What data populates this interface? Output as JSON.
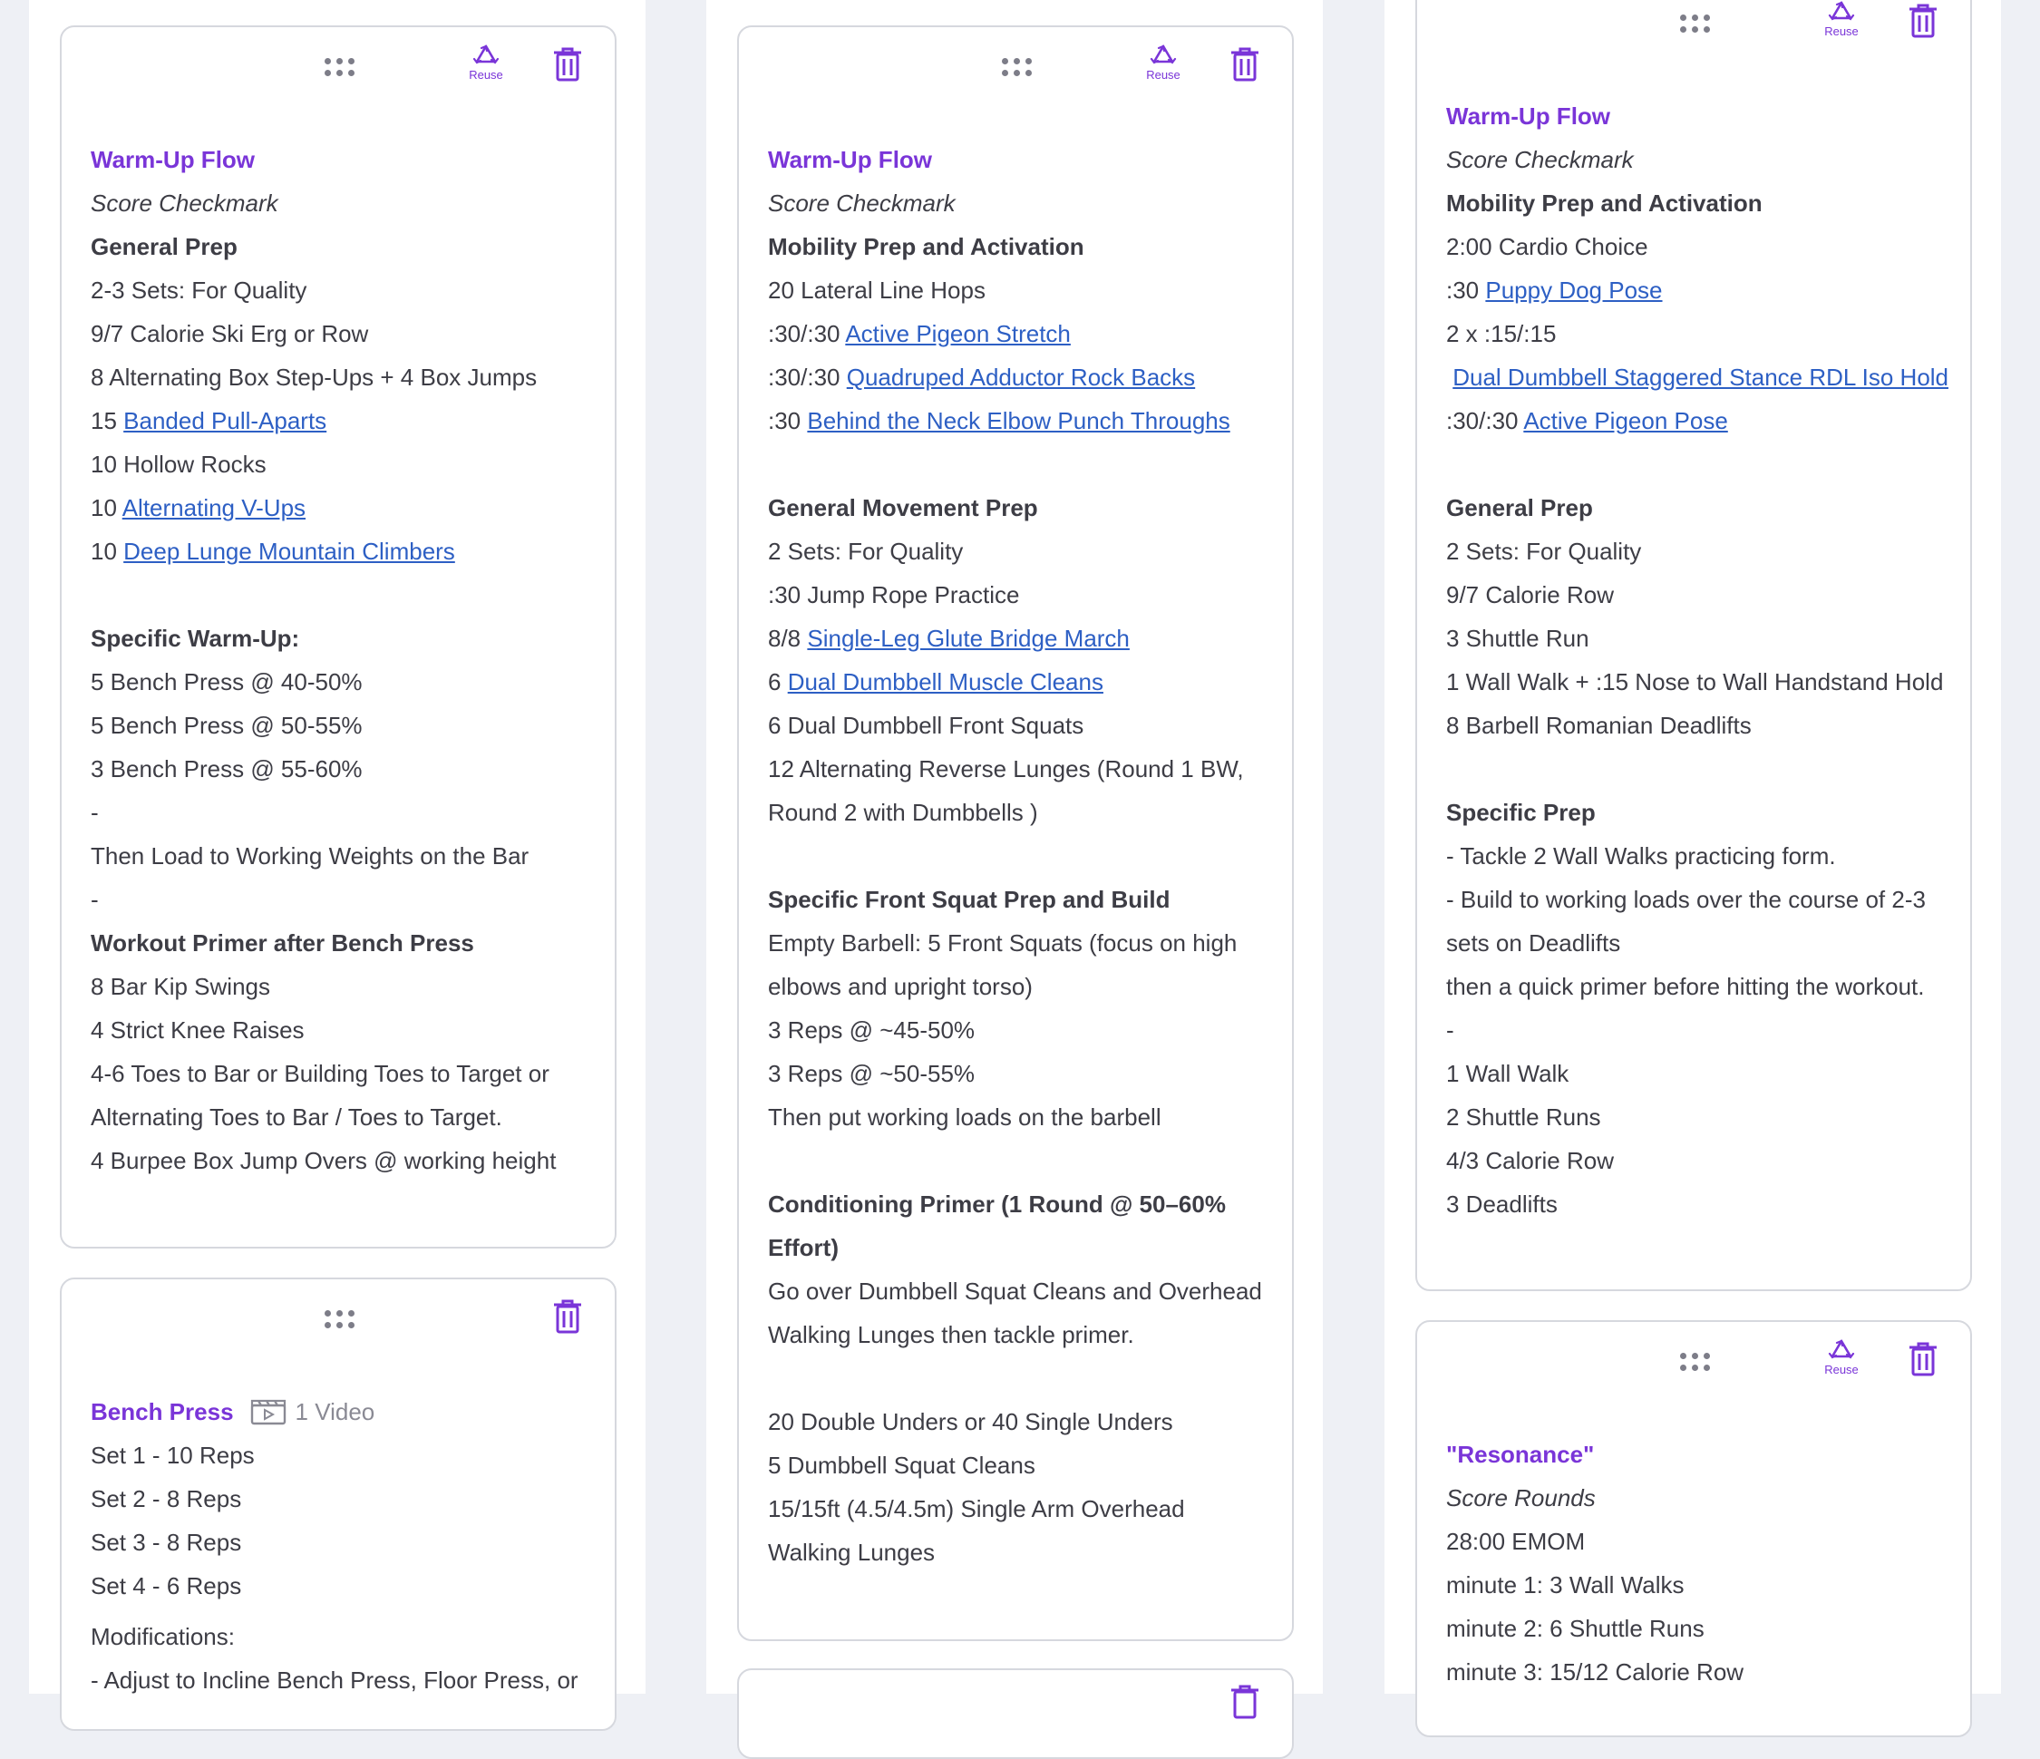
{
  "colors": {
    "accent": "#7a35d8",
    "link": "#2d5fc4",
    "text": "#3d3d45",
    "border": "#d6d8de",
    "background": "#eef0f5"
  },
  "icons": {
    "drag": "drag-dots-icon",
    "reuse": "recycle-icon",
    "delete": "trash-icon",
    "video": "video-clapper-icon"
  },
  "common": {
    "reuse_label": "Reuse"
  },
  "column1": {
    "card1": {
      "title": "Warm-Up Flow",
      "score": "Score Checkmark",
      "l1": "General Prep",
      "l2": "2-3 Sets: For Quality",
      "l3": "9/7 Calorie Ski Erg or Row",
      "l4": "8 Alternating Box Step-Ups + 4 Box Jumps",
      "l5_prefix": "15 ",
      "l5_link": "Banded Pull-Aparts",
      "l6": "10 Hollow Rocks",
      "l7_prefix": "10 ",
      "l7_link": "Alternating V-Ups",
      "l8_prefix": "10 ",
      "l8_link": "Deep Lunge Mountain Climbers",
      "l9": "Specific Warm-Up:",
      "l10": "5 Bench Press @ 40-50%",
      "l11": "5 Bench Press @ 50-55%",
      "l12": "3 Bench Press @ 55-60%",
      "l13": "-",
      "l14": "Then Load to Working Weights on the Bar",
      "l15": "-",
      "l16": "Workout Primer after Bench Press",
      "l17": "8 Bar Kip Swings",
      "l18": "4 Strict Knee Raises",
      "l19": "4-6 Toes to Bar or Building Toes to Target or",
      "l20": "Alternating Toes to Bar / Toes to Target.",
      "l21": "4 Burpee Box Jump Overs @ working height"
    },
    "card2": {
      "title": "Bench Press",
      "video_count": "1 Video",
      "l1": "Set 1 - 10 Reps",
      "l2": "Set 2 - 8 Reps",
      "l3": "Set 3 - 8 Reps",
      "l4": "Set 4 - 6 Reps",
      "l5": "Modifications:",
      "l6": "- Adjust to Incline Bench Press, Floor Press, or"
    }
  },
  "column2": {
    "card1": {
      "title": "Warm-Up Flow",
      "score": "Score Checkmark",
      "l1": "Mobility Prep and Activation",
      "l2": "20 Lateral Line Hops",
      "l3_prefix": ":30/:30 ",
      "l3_link": "Active Pigeon Stretch",
      "l4_prefix": ":30/:30 ",
      "l4_link": "Quadruped Adductor Rock Backs",
      "l5_prefix": ":30 ",
      "l5_link": "Behind the Neck Elbow Punch Throughs",
      "l6": "General Movement Prep",
      "l7": "2 Sets: For Quality",
      "l8": ":30 Jump Rope Practice",
      "l9_prefix": "8/8 ",
      "l9_link": "Single-Leg Glute Bridge March",
      "l10_prefix": "6 ",
      "l10_link": "Dual Dumbbell Muscle Cleans",
      "l11": "6 Dual Dumbbell Front Squats",
      "l12": "12 Alternating Reverse Lunges (Round 1 BW,",
      "l13": "Round 2 with Dumbbells )",
      "l14": "Specific Front Squat Prep and Build",
      "l15": "Empty Barbell: 5 Front Squats (focus on high",
      "l16": "elbows and upright torso)",
      "l17": "3 Reps @ ~45-50%",
      "l18": "3 Reps @ ~50-55%",
      "l19": "Then put working loads on the barbell",
      "l20": "Conditioning Primer (1 Round @ 50–60%",
      "l21": "Effort)",
      "l22": "Go over Dumbbell Squat Cleans and Overhead",
      "l23": "Walking Lunges then tackle primer.",
      "l24": "20 Double Unders or 40 Single Unders",
      "l25": "5 Dumbbell Squat Cleans",
      "l26": "15/15ft (4.5/4.5m) Single Arm Overhead",
      "l27": "Walking Lunges"
    }
  },
  "column3": {
    "card1": {
      "title": "Warm-Up Flow",
      "score": "Score Checkmark",
      "l1": "Mobility Prep and Activation",
      "l2": "2:00 Cardio Choice",
      "l3_prefix": ":30 ",
      "l3_link": "Puppy Dog Pose",
      "l4": "2 x :15/:15",
      "l5_link": "Dual Dumbbell Staggered Stance RDL Iso Hold",
      "l6_prefix": ":30/:30 ",
      "l6_link": "Active Pigeon Pose",
      "l7": "General Prep",
      "l8": "2 Sets: For Quality",
      "l9": "9/7 Calorie Row",
      "l10": "3 Shuttle Run",
      "l11": "1 Wall Walk + :15 Nose to Wall Handstand Hold",
      "l12": "8 Barbell Romanian Deadlifts",
      "l13": "Specific Prep",
      "l14": "- Tackle 2 Wall Walks practicing form.",
      "l15": "- Build to working loads over the course of 2-3",
      "l16": "sets on Deadlifts",
      "l17": "then a quick primer before hitting the workout.",
      "l18": "-",
      "l19": "1 Wall Walk",
      "l20": "2 Shuttle Runs",
      "l21": "4/3 Calorie Row",
      "l22": "3 Deadlifts"
    },
    "card2": {
      "title": "\"Resonance\"",
      "score": "Score Rounds",
      "l1": "28:00 EMOM",
      "l2": "minute 1: 3 Wall Walks",
      "l3": "minute 2: 6 Shuttle Runs",
      "l4": "minute 3: 15/12 Calorie Row"
    }
  }
}
